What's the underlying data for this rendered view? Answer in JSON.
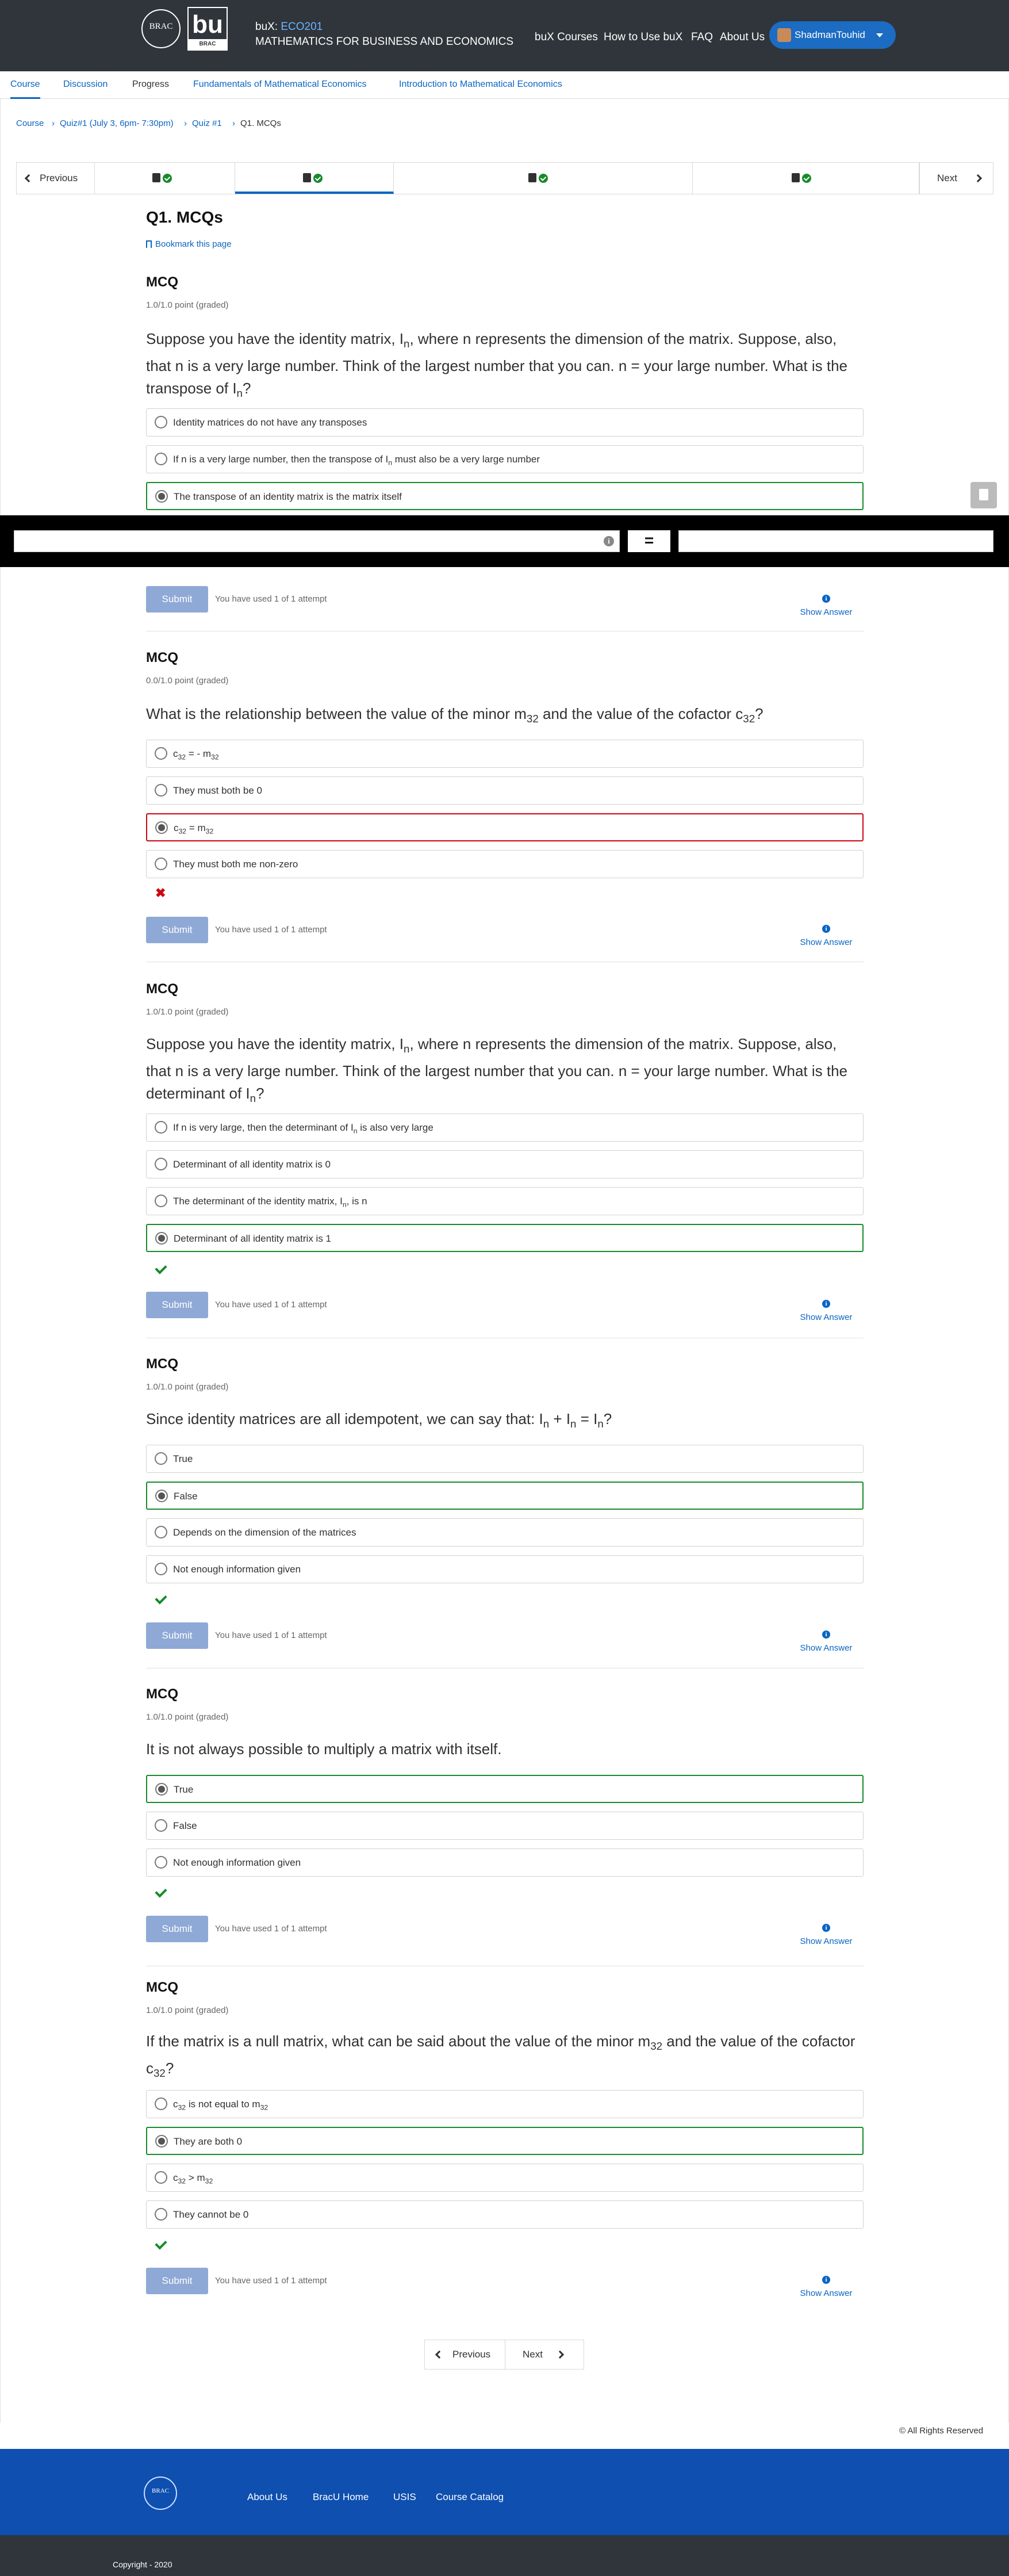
{
  "header": {
    "logo_brac": "BRAC",
    "logo_bux": "bu",
    "logo_bux_sub": "BRAC",
    "course_prefix": "buX:",
    "course_code": "ECO201",
    "course_name": "MATHEMATICS FOR BUSINESS AND ECONOMICS",
    "nav": [
      "buX Courses",
      "How to Use buX",
      "FAQ",
      "About Us"
    ],
    "username": "ShadmanTouhid"
  },
  "course_tabs": [
    "Course",
    "Discussion",
    "Progress",
    "Fundamentals of Mathematical Economics",
    "Introduction to Mathematical Economics"
  ],
  "breadcrumb": [
    "Course",
    "Quiz#1 (July 3, 6pm- 7:30pm)",
    "Quiz #1",
    "Q1. MCQs"
  ],
  "sequence": {
    "prev": "Previous",
    "next": "Next"
  },
  "unit": {
    "title": "Q1. MCQs",
    "bookmark": "Bookmark this page"
  },
  "problems": [
    {
      "heading": "MCQ",
      "points": "1.0/1.0 point (graded)",
      "question": [
        "Suppose you have the identity matrix, I",
        "n",
        ", where n represents the dimension of the matrix. Suppose, also, that n is a very large number. Think of the largest number that you can. n = your large number. What is the transpose of I",
        "n",
        "?"
      ],
      "options": [
        "Identity matrices do not have any transposes",
        "If n is a very large number, then the transpose of I",
        "n",
        " must also be a very large number",
        "The transpose of an identity matrix is the matrix itself"
      ],
      "submit": "Submit",
      "attempts": "You have used 1 of 1 attempt",
      "show_answer": "Show Answer"
    },
    {
      "heading": "MCQ",
      "points": "0.0/1.0 point (graded)",
      "question": [
        "What is the relationship between the value of the minor m",
        "32",
        " and the value of the cofactor c",
        "32",
        "?"
      ],
      "options": [
        "c",
        "32",
        " = - m",
        "32",
        "They must both be 0",
        "c",
        "32",
        " = m",
        "32",
        "They must both me non-zero"
      ],
      "submit": "Submit",
      "attempts": "You have used 1 of 1 attempt",
      "show_answer": "Show Answer"
    },
    {
      "heading": "MCQ",
      "points": "1.0/1.0 point (graded)",
      "question": [
        "Suppose you have the identity matrix, I",
        "n",
        ", where n represents the dimension of the matrix. Suppose, also, that n is a very large number. Think of the largest number that you can. n = your large number. What is the determinant of I",
        "n",
        "?"
      ],
      "options": [
        "If n is very large, then the determinant of I",
        "n",
        " is also very large",
        "Determinant of all identity matrix is 0",
        "The determinant of the identity matrix, I",
        "n",
        ", is n",
        "Determinant of all identity matrix is 1"
      ],
      "submit": "Submit",
      "attempts": "You have used 1 of 1 attempt",
      "show_answer": "Show Answer"
    },
    {
      "heading": "MCQ",
      "points": "1.0/1.0 point (graded)",
      "question": [
        "Since identity matrices are all idempotent, we can say that: I",
        "n",
        " + I",
        "n",
        " = I",
        "n",
        "?"
      ],
      "options": [
        "True",
        "False",
        "Depends on the dimension of the matrices",
        "Not enough information given"
      ],
      "submit": "Submit",
      "attempts": "You have used 1 of 1 attempt",
      "show_answer": "Show Answer"
    },
    {
      "heading": "MCQ",
      "points": "1.0/1.0 point (graded)",
      "question": [
        "It is not always possible to multiply a matrix with itself."
      ],
      "options": [
        "True",
        "False",
        "Not enough information given"
      ],
      "submit": "Submit",
      "attempts": "You have used 1 of 1 attempt",
      "show_answer": "Show Answer"
    },
    {
      "heading": "MCQ",
      "points": "1.0/1.0 point (graded)",
      "question": [
        "If the matrix is a null matrix, what can be said about the value of the minor m",
        "32",
        " and the value of the cofactor c",
        "32",
        "?"
      ],
      "options": [
        "c",
        "32",
        " is not equal to m",
        "32",
        "They are both 0",
        "c",
        "32",
        " > m",
        "32",
        "They cannot be 0"
      ],
      "submit": "Submit",
      "attempts": "You have used 1 of 1 attempt",
      "show_answer": "Show Answer"
    }
  ],
  "calculator": {
    "equals": "=",
    "info": "i"
  },
  "bottom_pager": {
    "prev": "Previous",
    "next": "Next"
  },
  "rights": "© All Rights Reserved",
  "footer": {
    "logo": "BRAC",
    "links": [
      "About Us",
      "BracU Home",
      "USIS",
      "Course Catalog"
    ],
    "copyright": "Copyright - 2020"
  },
  "colors": {
    "header_bg": "#2f353a",
    "link": "#0a65c2",
    "correct": "#178b2b",
    "incorrect": "#cb0712",
    "footer_bg": "#0e4fb0",
    "submit_bg": "#8fa9d6"
  }
}
